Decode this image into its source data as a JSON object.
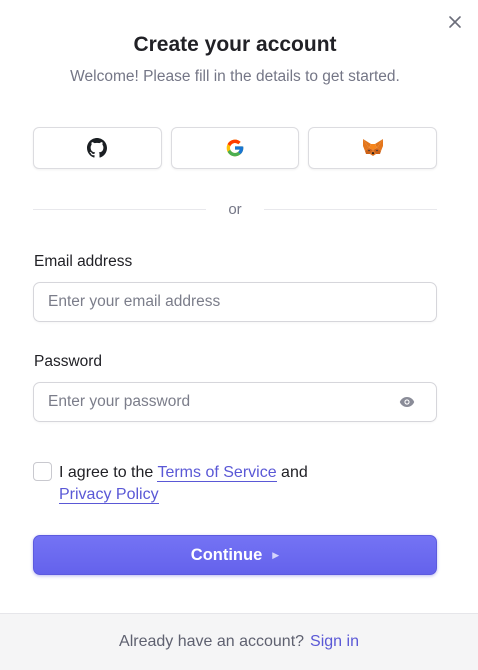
{
  "header": {
    "title": "Create your account",
    "subtitle": "Welcome! Please fill in the details to get started."
  },
  "social": {
    "providers": [
      {
        "name": "GitHub",
        "icon": "github-icon"
      },
      {
        "name": "Google",
        "icon": "google-icon"
      },
      {
        "name": "MetaMask",
        "icon": "metamask-icon"
      }
    ]
  },
  "divider": {
    "text": "or"
  },
  "form": {
    "email_label": "Email address",
    "email_placeholder": "Enter your email address",
    "email_value": "",
    "password_label": "Password",
    "password_placeholder": "Enter your password",
    "password_value": "",
    "terms_prefix": "I agree to the ",
    "terms_link": "Terms of Service",
    "terms_and": " and",
    "privacy_link": "Privacy Policy",
    "terms_checked": false,
    "continue_label": "Continue",
    "continue_icon": "triangle-right-icon"
  },
  "footer": {
    "text": "Already have an account?",
    "link": "Sign in"
  },
  "colors": {
    "accent": "#6c6bf1",
    "link": "#5a58d6",
    "text": "#212126",
    "muted": "#747686",
    "footer_bg": "#f5f5f6"
  },
  "icons": {
    "close": "close-icon",
    "eye": "eye-icon"
  }
}
